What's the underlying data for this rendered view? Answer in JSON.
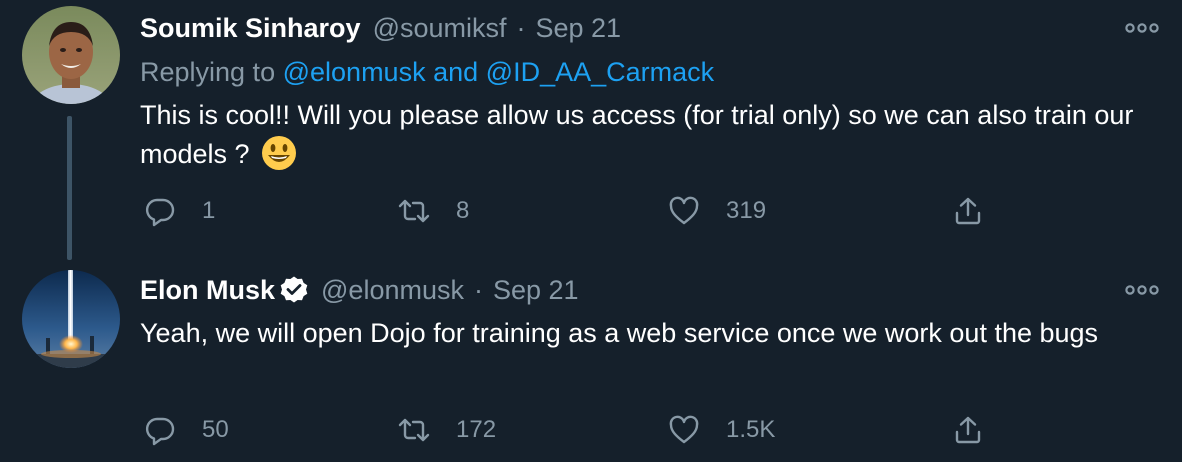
{
  "colors": {
    "background": "#15202b",
    "text_primary": "#ffffff",
    "text_secondary": "#8899a6",
    "link": "#1da1f2",
    "thread_line": "#3d5466"
  },
  "tweets": [
    {
      "display_name": "Soumik Sinharoy",
      "handle": "@soumiksf",
      "separator": "·",
      "date": "Sep 21",
      "replying_prefix": "Replying to",
      "replying_mention_1": "@elonmusk",
      "replying_and": "and",
      "replying_mention_2": "@ID_AA_Carmack",
      "text": "This is cool!! Will you please allow us access (for trial only) so we can also train our models ?",
      "emoji": "smiley-emoji",
      "replies": "1",
      "retweets": "8",
      "likes": "319"
    },
    {
      "display_name": "Elon Musk",
      "verified": true,
      "handle": "@elonmusk",
      "separator": "·",
      "date": "Sep 21",
      "text": "Yeah, we will open Dojo for training as a web service once we work out the bugs",
      "replies": "50",
      "retweets": "172",
      "likes": "1.5K"
    }
  ]
}
